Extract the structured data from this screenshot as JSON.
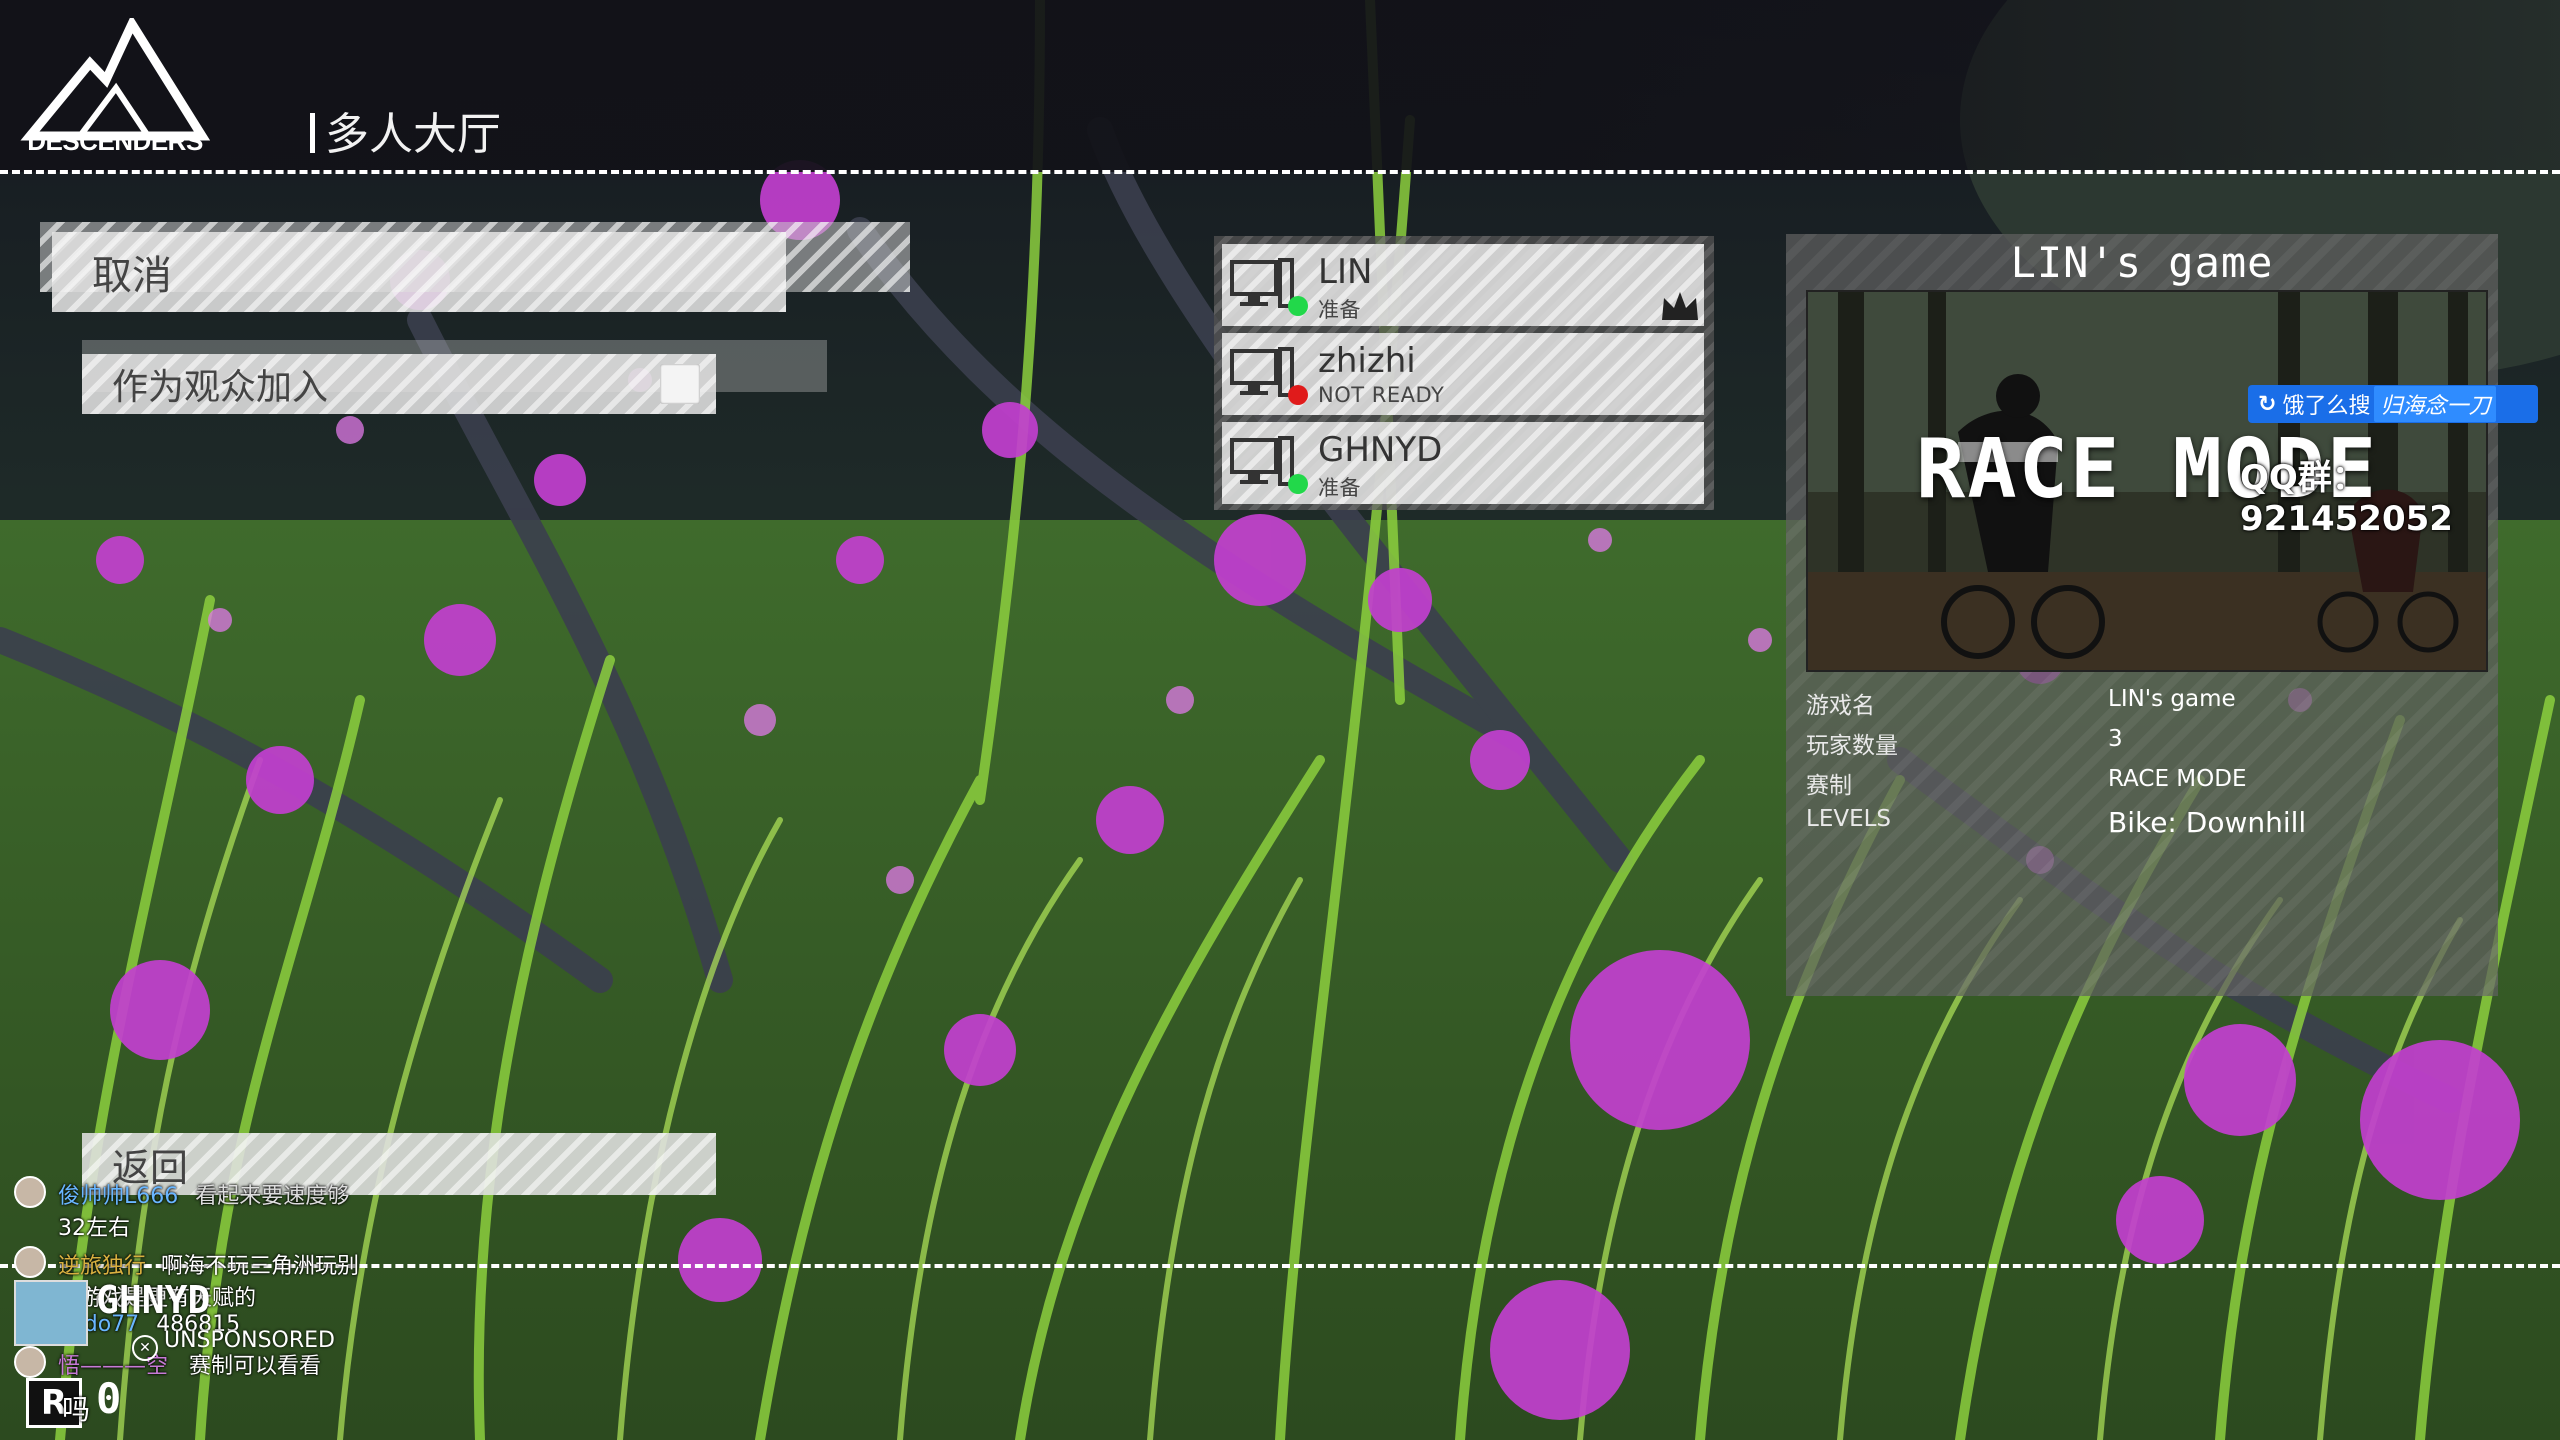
{
  "header": {
    "logo_text": "DESCENDERS",
    "title": "多人大厅"
  },
  "left_menu": {
    "cancel_label": "取消",
    "spectator_label": "作为观众加入",
    "spectator_checked": false,
    "back_label": "返回"
  },
  "players": [
    {
      "name": "LIN",
      "status": "准备",
      "status_color": "#22d84a",
      "host": true
    },
    {
      "name": "zhizhi",
      "status": "NOT READY",
      "status_color": "#e01b1b",
      "host": false
    },
    {
      "name": "GHNYD",
      "status": "准备",
      "status_color": "#22d84a",
      "host": false
    }
  ],
  "game_info": {
    "title": "LIN's game",
    "preview_text": "RACE MODE",
    "rows": [
      {
        "label": "游戏名",
        "value": "LIN's game"
      },
      {
        "label": "玩家数量",
        "value": "3"
      },
      {
        "label": "赛制",
        "value": "RACE MODE"
      },
      {
        "label": "LEVELS",
        "value": "Bike: Downhill"
      }
    ]
  },
  "overlay": {
    "ad_prefix": "饿了么搜",
    "ad_highlight": "归海念一刀",
    "qq": "QQ群：921452052"
  },
  "danmaku": [
    {
      "user": "俊帅帅L666",
      "text": "看起来要速度够"
    },
    {
      "user": "",
      "text": "32左右"
    },
    {
      "user": "逆旅独行",
      "text": "啊海不玩三角洲玩别"
    },
    {
      "user": "",
      "text": "的游戏是更有天赋的"
    },
    {
      "user": "liedo77",
      "text": "486815"
    },
    {
      "user": "悟———空",
      "text": "赛制可以看看"
    }
  ],
  "bottom_profile": {
    "name": "GHNYD",
    "sponsor": "UNSPONSORED",
    "rank_letter": "R",
    "rank_suffix": "吗",
    "score": "0"
  },
  "colors": {
    "accent_ready": "#22d84a",
    "accent_not_ready": "#e01b1b",
    "ad_blue": "#1a6ee8"
  }
}
